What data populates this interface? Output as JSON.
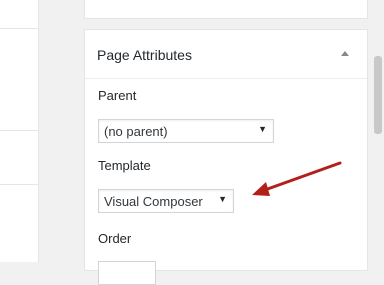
{
  "page_attributes": {
    "title": "Page Attributes",
    "parent_label": "Parent",
    "parent_value": "(no parent)",
    "template_label": "Template",
    "template_value": "Visual Composer",
    "order_label": "Order"
  },
  "colors": {
    "annotation_arrow": "#b3201b",
    "panel_border": "#e5e5e5",
    "background": "#f1f1f1"
  },
  "icons": {
    "toggle": "triangle-up-icon",
    "select_caret": "caret-down-icon",
    "annotation": "red-arrow-annotation"
  }
}
